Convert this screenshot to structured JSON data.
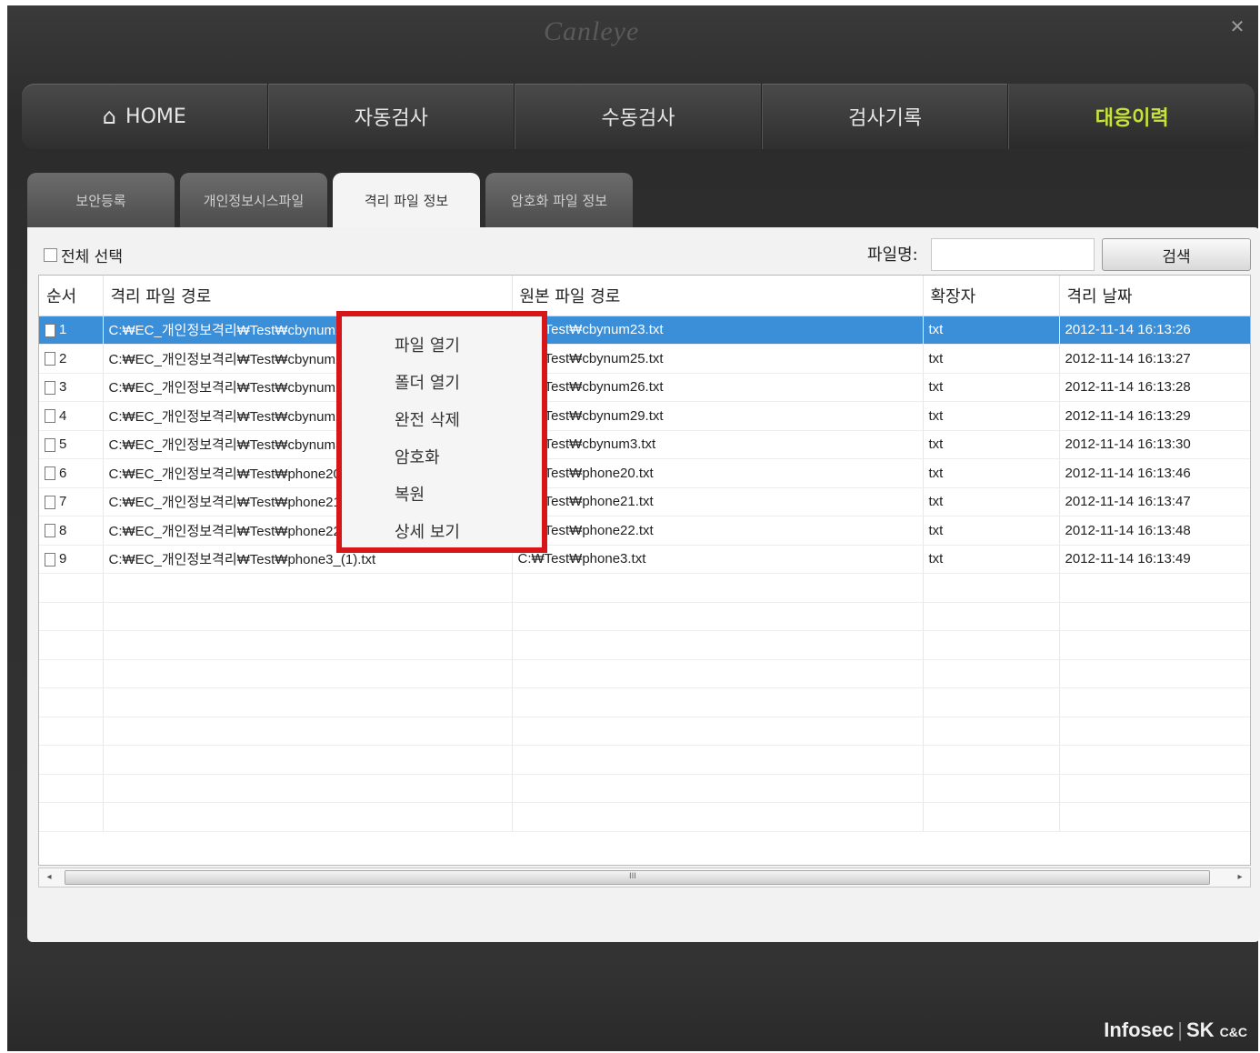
{
  "window": {
    "logo_text": "Canleye",
    "close_glyph": "✕"
  },
  "main_nav": [
    {
      "label": "HOME",
      "icon": "home-icon"
    },
    {
      "label": "자동검사"
    },
    {
      "label": "수동검사"
    },
    {
      "label": "검사기록"
    },
    {
      "label": "대응이력",
      "active": true
    }
  ],
  "sub_tabs": [
    {
      "label": "보안등록"
    },
    {
      "label": "개인정보시스파일"
    },
    {
      "label": "격리 파일 정보",
      "active": true
    },
    {
      "label": "암호화 파일 정보"
    }
  ],
  "toolbar": {
    "select_all_label": "전체 선택",
    "filename_label": "파일명:",
    "filename_value": "",
    "search_label": "검색"
  },
  "table": {
    "columns": [
      "순서",
      "격리 파일 경로",
      "원본 파일 경로",
      "확장자",
      "격리 날짜"
    ],
    "rows": [
      {
        "no": "1",
        "quarantine_path": "C:₩EC_개인정보격리₩Test₩cbynum23.txt",
        "original_path": "C:₩Test₩cbynum23.txt",
        "ext": "txt",
        "date": "2012-11-14 16:13:26",
        "selected": true
      },
      {
        "no": "2",
        "quarantine_path": "C:₩EC_개인정보격리₩Test₩cbynum25.txt",
        "original_path": "C:₩Test₩cbynum25.txt",
        "ext": "txt",
        "date": "2012-11-14 16:13:27"
      },
      {
        "no": "3",
        "quarantine_path": "C:₩EC_개인정보격리₩Test₩cbynum26.txt",
        "original_path": "C:₩Test₩cbynum26.txt",
        "ext": "txt",
        "date": "2012-11-14 16:13:28"
      },
      {
        "no": "4",
        "quarantine_path": "C:₩EC_개인정보격리₩Test₩cbynum29.txt",
        "original_path": "C:₩Test₩cbynum29.txt",
        "ext": "txt",
        "date": "2012-11-14 16:13:29"
      },
      {
        "no": "5",
        "quarantine_path": "C:₩EC_개인정보격리₩Test₩cbynum3.txt",
        "original_path": "C:₩Test₩cbynum3.txt",
        "ext": "txt",
        "date": "2012-11-14 16:13:30"
      },
      {
        "no": "6",
        "quarantine_path": "C:₩EC_개인정보격리₩Test₩phone20.txt",
        "original_path": "C:₩Test₩phone20.txt",
        "ext": "txt",
        "date": "2012-11-14 16:13:46"
      },
      {
        "no": "7",
        "quarantine_path": "C:₩EC_개인정보격리₩Test₩phone21.txt",
        "original_path": "C:₩Test₩phone21.txt",
        "ext": "txt",
        "date": "2012-11-14 16:13:47"
      },
      {
        "no": "8",
        "quarantine_path": "C:₩EC_개인정보격리₩Test₩phone22.txt",
        "original_path": "C:₩Test₩phone22.txt",
        "ext": "txt",
        "date": "2012-11-14 16:13:48"
      },
      {
        "no": "9",
        "quarantine_path": "C:₩EC_개인정보격리₩Test₩phone3_(1).txt",
        "original_path": "C:₩Test₩phone3.txt",
        "ext": "txt",
        "date": "2012-11-14 16:13:49"
      }
    ]
  },
  "context_menu": [
    "파일 열기",
    "폴더 열기",
    "완전 삭제",
    "암호화",
    "복원",
    "상세 보기"
  ],
  "scrollbar": {
    "left_arrow": "◂",
    "right_arrow": "▸",
    "grip": "III"
  },
  "brand": {
    "name": "Infosec",
    "partner": "SK",
    "partner_sub": "C&C"
  }
}
